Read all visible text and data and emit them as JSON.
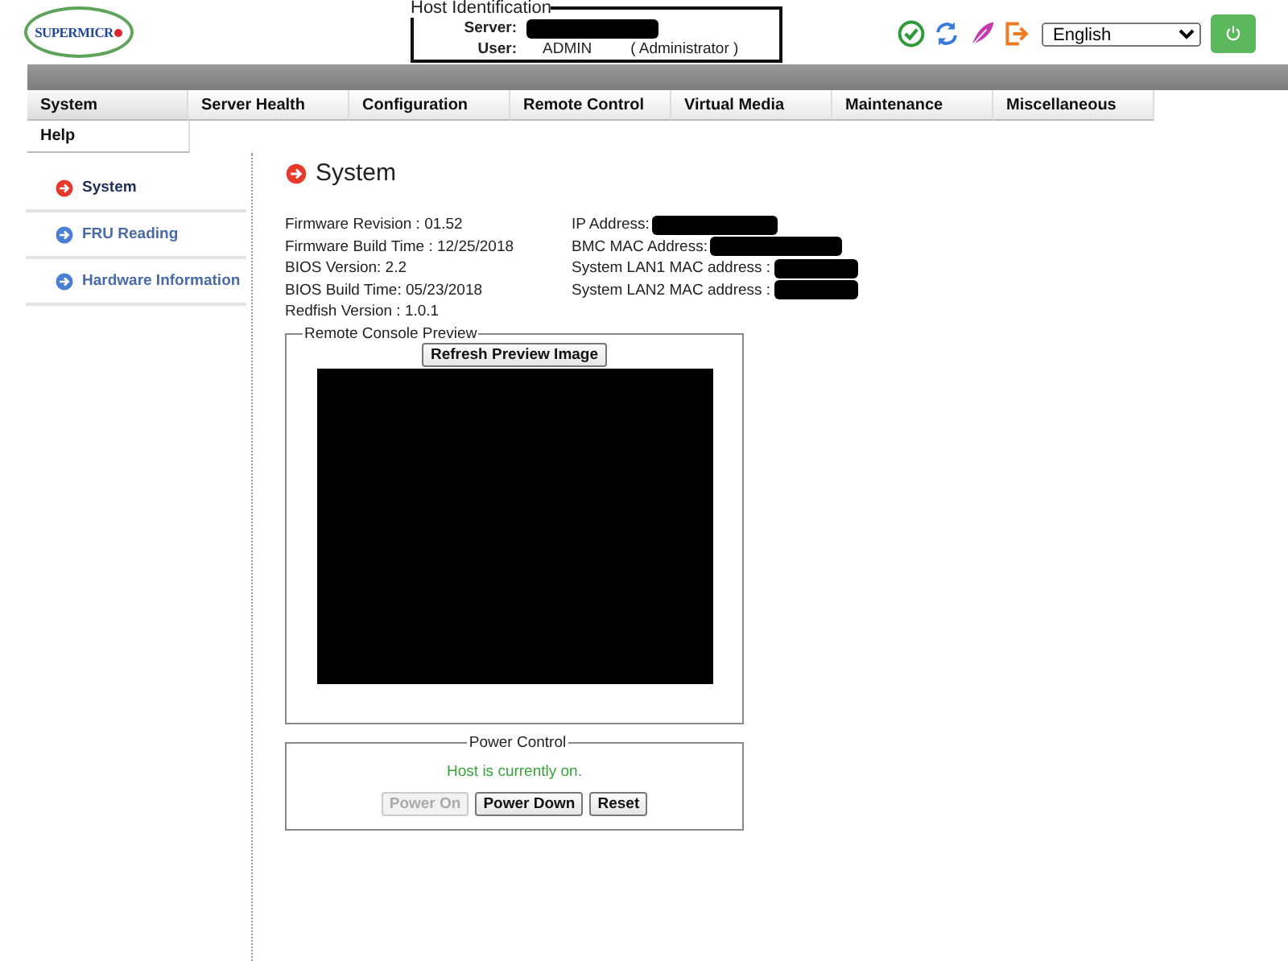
{
  "logo": {
    "text": "SUPERMICR"
  },
  "host": {
    "title": "Host Identification",
    "server_label": "Server:",
    "user_label": "User:",
    "user": "ADMIN",
    "role": "( Administrator )"
  },
  "language": {
    "value": "English"
  },
  "menu": [
    {
      "label": "System",
      "selected": true
    },
    {
      "label": "Server Health",
      "selected": false
    },
    {
      "label": "Configuration",
      "selected": false
    },
    {
      "label": "Remote Control",
      "selected": false
    },
    {
      "label": "Virtual Media",
      "selected": false
    },
    {
      "label": "Maintenance",
      "selected": false
    },
    {
      "label": "Miscellaneous",
      "selected": false
    },
    {
      "label": "Help",
      "selected": false
    }
  ],
  "sidebar": {
    "items": [
      {
        "label": "System",
        "selected": true
      },
      {
        "label": "FRU Reading",
        "selected": false
      },
      {
        "label": "Hardware Information",
        "selected": false
      }
    ]
  },
  "page_title": "System",
  "info_left": [
    "Firmware Revision :  01.52",
    "Firmware Build Time :  12/25/2018",
    "BIOS Version: 2.2",
    "BIOS Build Time: 05/23/2018",
    "Redfish Version : 1.0.1"
  ],
  "info_right": [
    "IP Address:",
    "BMC MAC Address:",
    "System LAN1 MAC address :",
    "System LAN2 MAC address :"
  ],
  "preview": {
    "legend": "Remote Console Preview",
    "button": "Refresh Preview Image"
  },
  "power": {
    "legend": "Power Control",
    "status": "Host is currently on.",
    "buttons": [
      {
        "label": "Power On",
        "disabled": true
      },
      {
        "label": "Power Down",
        "disabled": false
      },
      {
        "label": "Reset",
        "disabled": false
      }
    ]
  }
}
